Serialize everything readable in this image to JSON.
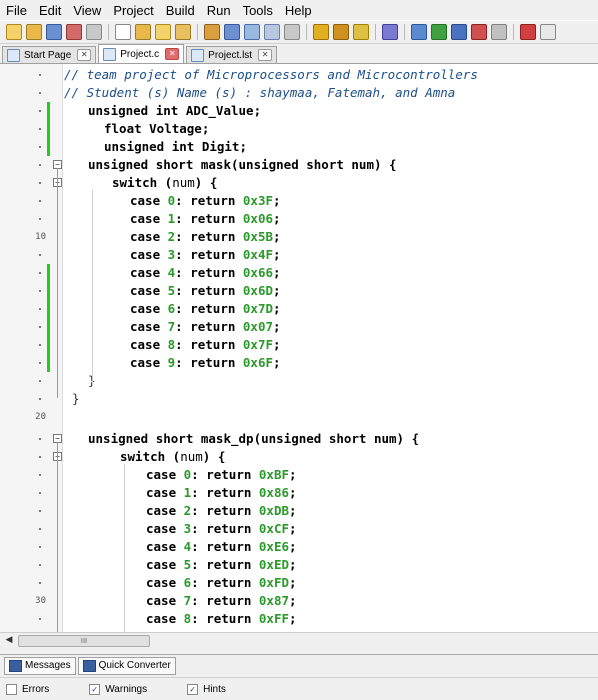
{
  "menubar": {
    "items": [
      "File",
      "Edit",
      "View",
      "Project",
      "Build",
      "Run",
      "Tools",
      "Help"
    ]
  },
  "tabs": [
    {
      "label": "Start Page",
      "active": false
    },
    {
      "label": "Project.c",
      "active": true
    },
    {
      "label": "Project.lst",
      "active": false
    }
  ],
  "editor": {
    "line_numbers": {
      "10": "10",
      "20": "20",
      "30": "30"
    },
    "lines": [
      "// team project of Microprocessors and Microcontrollers",
      "// Student (s) Name (s) : shaymaa, Fatemah, and Amna",
      "unsigned int ADC_Value;",
      "float Voltage;",
      "unsigned int Digit;",
      "unsigned short mask(unsigned short num) {",
      "switch (num) {",
      "case 0: return 0x3F;",
      "case 1: return 0x06;",
      "case 2: return 0x5B;",
      "case 3: return 0x4F;",
      "case 4: return 0x66;",
      "case 5: return 0x6D;",
      "case 6: return 0x7D;",
      "case 7: return 0x07;",
      "case 8: return 0x7F;",
      "case 9: return 0x6F;",
      "}",
      "}",
      "",
      "unsigned short mask_dp(unsigned short num) {",
      "switch (num) {",
      "case 0: return 0xBF;",
      "case 1: return 0x86;",
      "case 2: return 0xDB;",
      "case 3: return 0xCF;",
      "case 4: return 0xE6;",
      "case 5: return 0xED;",
      "case 6: return 0xFD;",
      "case 7: return 0x87;",
      "case 8: return 0xFF;"
    ]
  },
  "scrollbar": {
    "thumb_grip": "III"
  },
  "bottom_tabs": [
    "Messages",
    "Quick Converter"
  ],
  "filters": [
    {
      "label": "Errors",
      "checked": false
    },
    {
      "label": "Warnings",
      "checked": true
    },
    {
      "label": "Hints",
      "checked": true
    }
  ],
  "colors": {
    "comment": "#1d4f8a",
    "number": "#2a9a2a",
    "change_bar": "#22cc22"
  },
  "icons": [
    "new-file-icon",
    "open-icon",
    "save-icon",
    "build-icon",
    "run-icon",
    "stop-icon",
    "search-icon"
  ]
}
